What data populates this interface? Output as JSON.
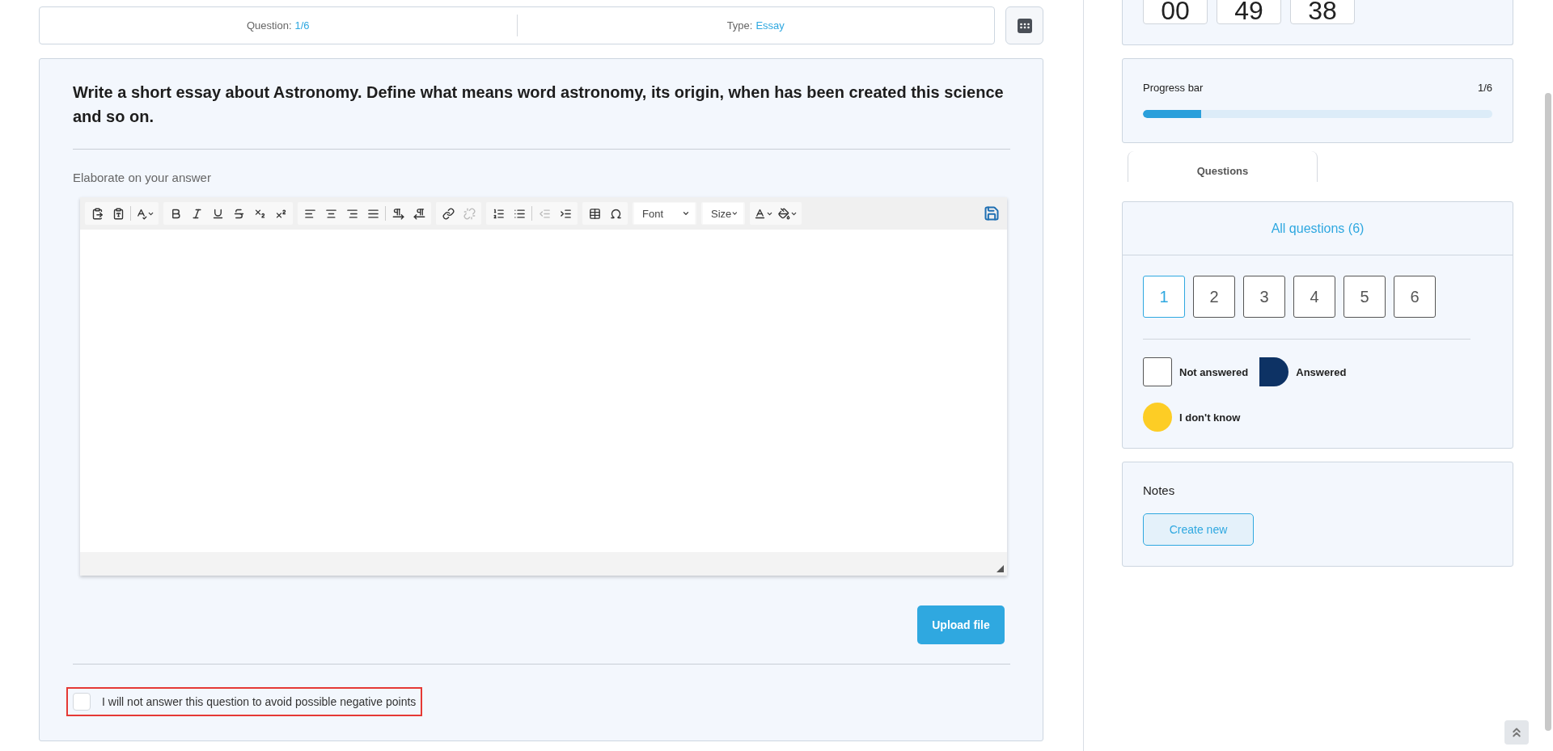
{
  "header": {
    "question_label": "Question:",
    "question_value": "1/6",
    "type_label": "Type:",
    "type_value": "Essay"
  },
  "question": {
    "text": "Write a short essay about Astronomy. Define what means word astronomy, its origin, when has been created this science and so on.",
    "prompt": "Elaborate on your answer"
  },
  "editor": {
    "toolbar": [
      [
        {
          "kind": "paste",
          "disabled": false
        },
        {
          "kind": "paste-text",
          "disabled": false
        },
        {
          "kind": "separator"
        },
        {
          "kind": "spellcheck",
          "disabled": false
        }
      ],
      [
        {
          "kind": "bold",
          "disabled": false
        },
        {
          "kind": "italic",
          "disabled": false
        },
        {
          "kind": "underline",
          "disabled": false
        },
        {
          "kind": "strikethrough",
          "disabled": false
        },
        {
          "kind": "subscript",
          "disabled": false
        },
        {
          "kind": "superscript",
          "disabled": false
        }
      ],
      [
        {
          "kind": "align-left",
          "disabled": false
        },
        {
          "kind": "align-center",
          "disabled": false
        },
        {
          "kind": "align-right",
          "disabled": false
        },
        {
          "kind": "justify",
          "disabled": false
        },
        {
          "kind": "separator"
        },
        {
          "kind": "ltr",
          "disabled": false
        },
        {
          "kind": "rtl",
          "disabled": false
        }
      ],
      [
        {
          "kind": "link",
          "disabled": false
        },
        {
          "kind": "unlink",
          "disabled": true
        }
      ],
      [
        {
          "kind": "numbered-list",
          "disabled": false
        },
        {
          "kind": "bulleted-list",
          "disabled": false
        },
        {
          "kind": "separator"
        },
        {
          "kind": "outdent",
          "disabled": true
        },
        {
          "kind": "indent",
          "disabled": false
        }
      ],
      [
        {
          "kind": "table",
          "disabled": false
        },
        {
          "kind": "special-character",
          "disabled": false
        }
      ],
      [
        {
          "kind": "dropdown",
          "label": "Font",
          "disabled": false
        }
      ],
      [
        {
          "kind": "dropdown",
          "label": "Size",
          "disabled": false
        }
      ],
      [
        {
          "kind": "text-color",
          "disabled": false
        },
        {
          "kind": "background-color",
          "disabled": false
        }
      ]
    ]
  },
  "upload_button": "Upload file",
  "skip": {
    "label": "I will not answer this question to avoid possible negative points",
    "checked": false
  },
  "timer": [
    "00",
    "49",
    "38"
  ],
  "progress": {
    "label": "Progress bar",
    "reading": "1/6",
    "level": 0.1667
  },
  "tabs": [
    {
      "label": "Questions"
    }
  ],
  "navigator": {
    "title": "All questions (6)",
    "questions": [
      {
        "label": "1",
        "selected": true
      },
      {
        "label": "2",
        "selected": false
      },
      {
        "label": "3",
        "selected": false
      },
      {
        "label": "4",
        "selected": false
      },
      {
        "label": "5",
        "selected": false
      },
      {
        "label": "6",
        "selected": false
      }
    ],
    "legend": [
      {
        "kind": "empty",
        "label": "Not answered",
        "color": "#ffffff"
      },
      {
        "kind": "answered",
        "label": "Answered",
        "color": "#0d3264"
      },
      {
        "kind": "unknown",
        "label": "I don't know",
        "color": "#fdcd25"
      }
    ]
  },
  "notes": {
    "title": "Notes",
    "button": "Create new"
  }
}
